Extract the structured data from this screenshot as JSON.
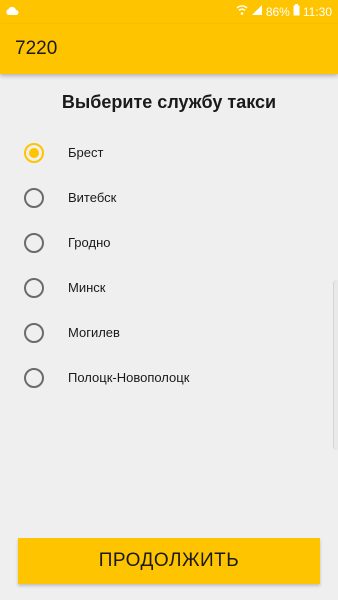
{
  "status_bar": {
    "battery": "86%",
    "time": "11:30",
    "icons": [
      "cloud-icon",
      "wifi-icon",
      "signal-icon",
      "battery-icon"
    ]
  },
  "app_bar": {
    "title": "7220"
  },
  "heading": "Выберите службу такси",
  "options": [
    {
      "label": "Брест",
      "selected": true
    },
    {
      "label": "Витебск",
      "selected": false
    },
    {
      "label": "Гродно",
      "selected": false
    },
    {
      "label": "Минск",
      "selected": false
    },
    {
      "label": "Могилев",
      "selected": false
    },
    {
      "label": "Полоцк-Новополоцк",
      "selected": false
    }
  ],
  "continue_label": "ПРОДОЛЖИТЬ",
  "colors": {
    "accent": "#ffc400",
    "background": "#efefef",
    "radio_off": "#6b6b6b"
  }
}
